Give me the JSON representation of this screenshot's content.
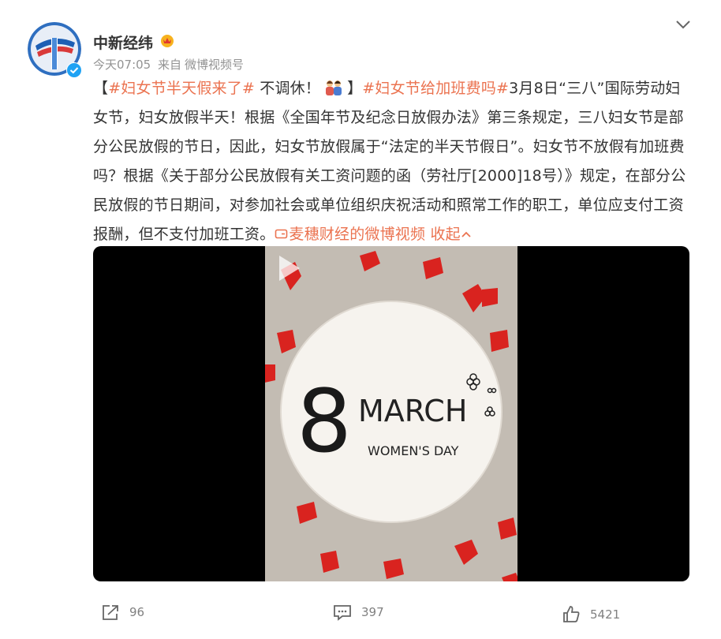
{
  "post": {
    "username": "中新经纬",
    "time": "今天07:05",
    "source_prefix": "来自",
    "source": "微博视频号",
    "content": {
      "bracket_open": "【",
      "tag1": "#妇女节半天假来了#",
      "t1": " 不调休！",
      "bracket_close": "】",
      "tag2": "#妇女节给加班费吗#",
      "t2": "3月8日“三八”国际劳动妇女节，妇女放假半天！根据《全国年节及纪念日放假办法》第三条规定，三八妇女节是部分公民放假的节日，因此，妇女节放假属于“法定的半天节假日”。妇女节不放假有加班费吗？根据《关于部分公民放假有关工资问题的函（劳社厅[2000]18号）》规定，在部分公民放假的节日期间，对参加社会或单位组织庆祝活动和照常工作的职工，单位应支付工资报酬，但不支付加班工资。",
      "video_link": "麦穗财经的微博视频",
      "collapse": "收起"
    },
    "video": {
      "number": "8",
      "march": "MARCH",
      "womens_day": "WOMEN'S DAY"
    },
    "actions": {
      "repost": "96",
      "comment": "397",
      "like": "5421"
    }
  },
  "colors": {
    "accent": "#eb7350",
    "verify": "#1fa2f4"
  },
  "icons": [
    "avatar-logo",
    "vip-crown-icon",
    "verified-icon",
    "chevron-down-icon",
    "video-link-icon",
    "chevron-up-icon",
    "play-icon",
    "repost-icon",
    "comment-icon",
    "like-icon"
  ]
}
